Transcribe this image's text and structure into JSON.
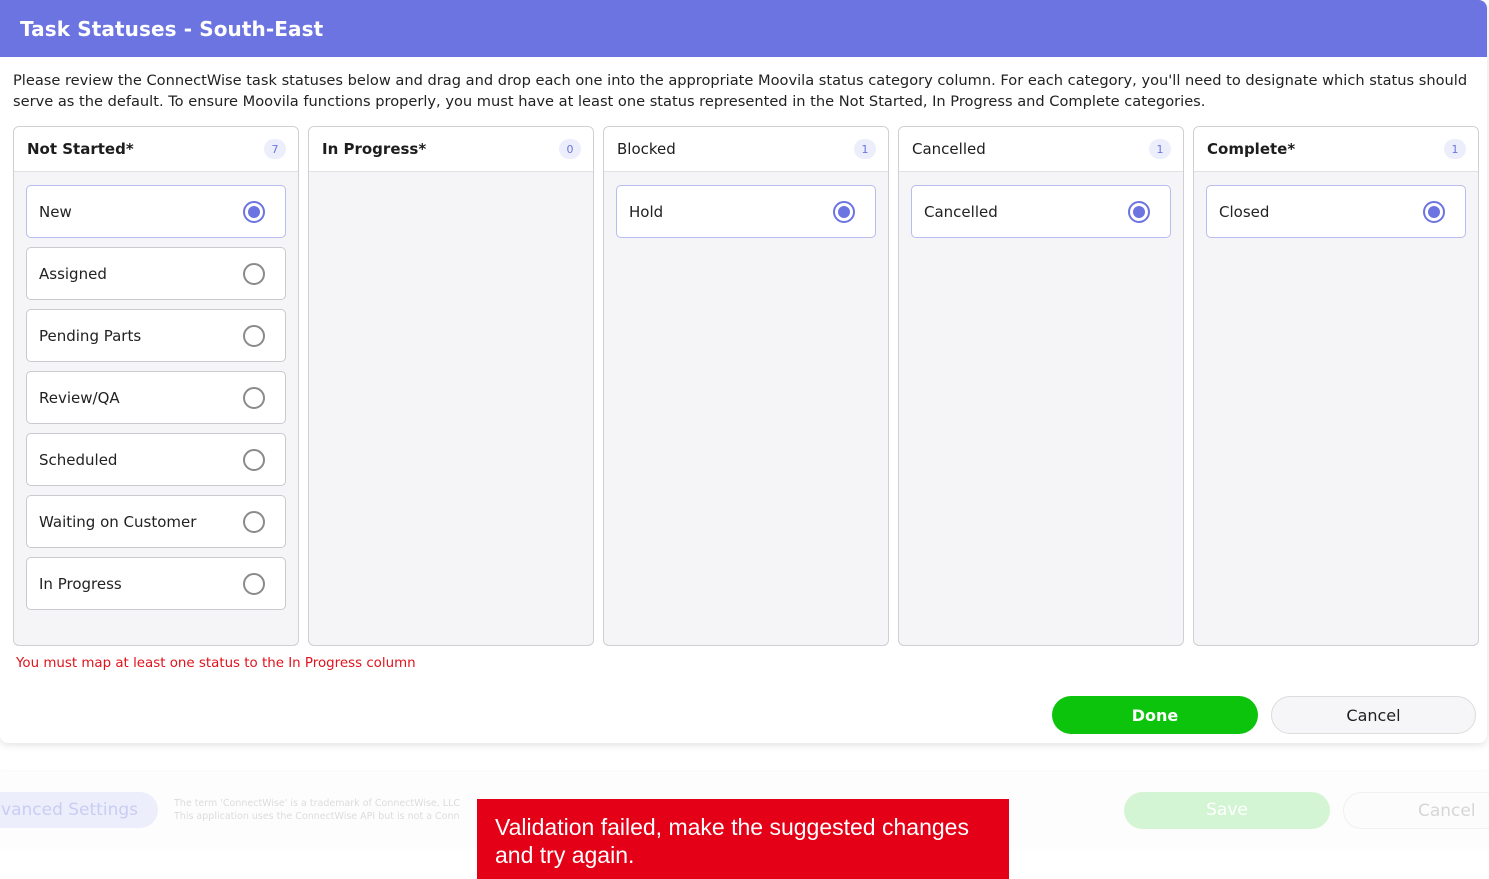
{
  "modal": {
    "title": "Task Statuses - South-East",
    "instructions": "Please review the ConnectWise task statuses below and drag and drop each one into the appropriate Moovila status category column. For each category, you'll need to designate which status should serve as the default. To ensure Moovila functions properly, you must have at least one status represented in the Not Started, In Progress and Complete categories.",
    "columns": [
      {
        "title": "Not Started*",
        "count": "7",
        "statuses": [
          {
            "label": "New",
            "default": true
          },
          {
            "label": "Assigned",
            "default": false
          },
          {
            "label": "Pending Parts",
            "default": false
          },
          {
            "label": "Review/QA",
            "default": false
          },
          {
            "label": "Scheduled",
            "default": false
          },
          {
            "label": "Waiting on Customer",
            "default": false
          },
          {
            "label": "In Progress",
            "default": false
          }
        ]
      },
      {
        "title": "In Progress*",
        "count": "0",
        "statuses": []
      },
      {
        "title": "Blocked",
        "count": "1",
        "statuses": [
          {
            "label": "Hold",
            "default": true
          }
        ]
      },
      {
        "title": "Cancelled",
        "count": "1",
        "statuses": [
          {
            "label": "Cancelled",
            "default": true
          }
        ]
      },
      {
        "title": "Complete*",
        "count": "1",
        "statuses": [
          {
            "label": "Closed",
            "default": true
          }
        ]
      }
    ],
    "error": "You must map at least one status to the In Progress column",
    "done_label": "Done",
    "cancel_label": "Cancel"
  },
  "background": {
    "advanced_settings_label": "Advanced Settings",
    "trademark_line1": "The term 'ConnectWise' is a trademark of ConnectWise, LLC",
    "trademark_line2": "This application uses the ConnectWise API but is not a Conn",
    "save_label": "Save",
    "cancel_label": "Cancel"
  },
  "toast": {
    "message": "Validation failed, make the suggested changes and try again."
  },
  "colors": {
    "header": "#6c74e1",
    "accent": "#6c74e1",
    "done": "#0dc40d",
    "error": "#e0121b",
    "toast": "#e40016"
  }
}
